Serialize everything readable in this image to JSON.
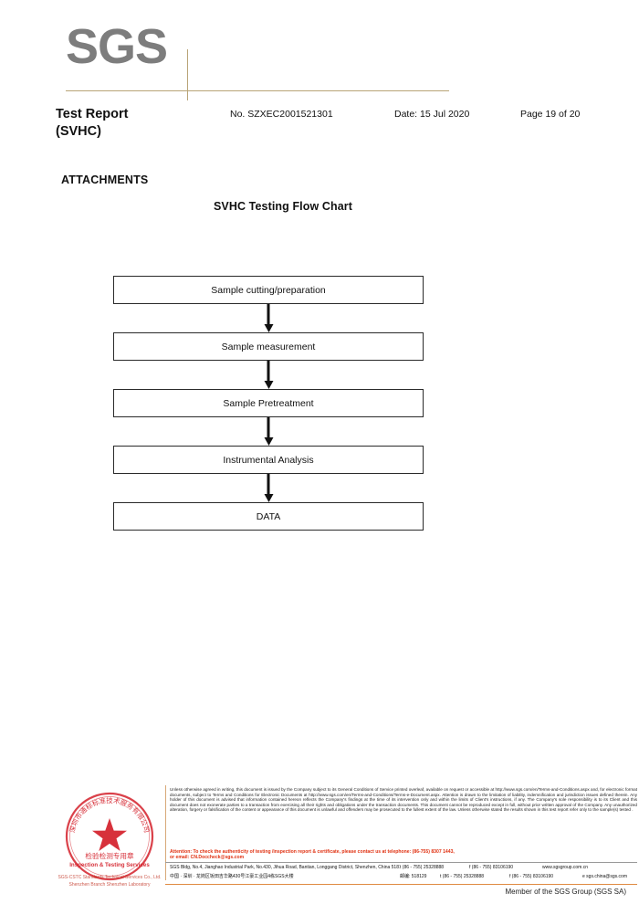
{
  "header": {
    "logo_text": "SGS",
    "report_title": "Test Report\n(SVHC)",
    "report_no": "No. SZXEC2001521301",
    "date": "Date: 15 Jul 2020",
    "page": "Page 19 of 20"
  },
  "body": {
    "attachments_heading": "ATTACHMENTS",
    "flow_chart_title": "SVHC Testing Flow Chart",
    "flow_steps": [
      "Sample cutting/preparation",
      "Sample measurement",
      "Sample Pretreatment",
      "Instrumental Analysis",
      "DATA"
    ]
  },
  "footer": {
    "seal": {
      "outer_text_cn": "深圳市通标标准技术服务有限公司",
      "center_cn": "检验检测专用章",
      "center_en": "Inspection & Testing Services",
      "bottom_line1": "SGS-CSTC Standards Technical Services Co., Ltd.",
      "bottom_line2": "Shenzhen Branch    Shenzhen Laboratory",
      "color": "#d4202a"
    },
    "legal_text": "Unless otherwise agreed in writing, this document is issued by the Company subject to its General Conditions of Service printed overleaf, available on request or accessible at http://www.sgs.com/en/Terms-and-Conditions.aspx and, for electronic format documents, subject to Terms and Conditions for Electronic Documents at http://www.sgs.com/en/Terms-and-Conditions/Terms-e-Document.aspx. Attention is drawn to the limitation of liability, indemnification and jurisdiction issues defined therein. Any holder of this document is advised that information contained hereon reflects the Company's findings at the time of its intervention only and within the limits of Client's instructions, if any. The Company's sole responsibility is to its Client and this document does not exonerate parties to a transaction from exercising all their rights and obligations under the transaction documents. This document cannot be reproduced except in full, without prior written approval of the Company. Any unauthorized alteration, forgery or falsification of the content or appearance of this document is unlawful and offenders may be prosecuted to the fullest extent of the law. Unless otherwise stated the results shown in this test report refer only to the sample(s) tested .",
    "attention_line1": "Attention: To check the authenticity of testing /inspection report & certificate, please contact us at telephone: (86-755) 8307 1443,",
    "attention_line2": "or email: CN.Doccheck@sgs.com",
    "address_en": "SGS Bldg, No.4, Jianghao Industrial Park, No.430, Jihua Road, Bantian, Longgang District, Shenzhen, China 518129",
    "address_cn": "中国 · 深圳 · 龙岗区坂田吉华路430号江豪工业园4栋SGS大楼",
    "zip_en": "",
    "zip_cn": "邮编: 518129",
    "tel_en": "t (86 - 755) 25328888",
    "tel_cn": "t (86 - 755) 25328888",
    "fax_en": "f (86 - 755) 83106190",
    "fax_cn": "f (86 - 755) 83106190",
    "web_en": "www.sgsgroup.com.cn",
    "web_cn": "e sgs.china@sgs.com",
    "member_line": "Member of the SGS Group (SGS SA)"
  }
}
